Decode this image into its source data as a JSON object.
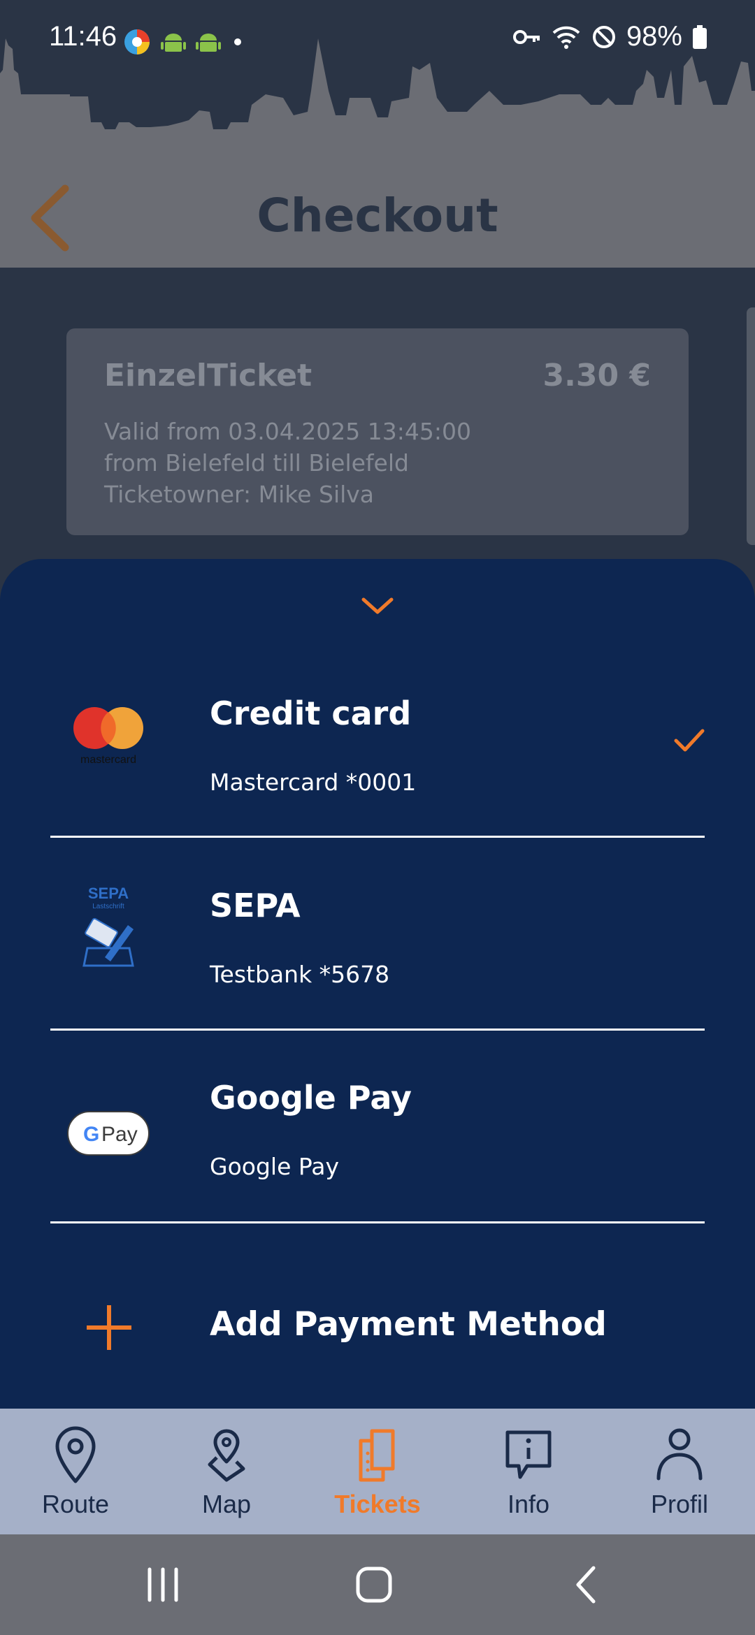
{
  "status_bar": {
    "time": "11:46",
    "battery": "98%"
  },
  "header": {
    "title": "Checkout",
    "back_icon": "chevron-left-icon"
  },
  "ticket": {
    "name": "EinzelTicket",
    "price": "3.30 €",
    "valid_from": "Valid from 03.04.2025 13:45:00",
    "route": "from Bielefeld till Bielefeld",
    "owner": "Ticketowner: Mike Silva"
  },
  "payment_sheet": {
    "collapse_icon": "chevron-down-icon",
    "methods": [
      {
        "title": "Credit card",
        "subtitle": "Mastercard *0001",
        "logo_text": "mastercard",
        "selected": true
      },
      {
        "title": "SEPA",
        "subtitle": "Testbank *5678",
        "logo_text": "SEPA",
        "logo_subtext": "Lastschrift",
        "selected": false
      },
      {
        "title": "Google Pay",
        "subtitle": "Google Pay",
        "logo_text": "Pay",
        "selected": false
      }
    ],
    "add_label": "Add Payment Method"
  },
  "bottom_nav": {
    "items": [
      {
        "label": "Route",
        "icon": "location-pin-icon"
      },
      {
        "label": "Map",
        "icon": "map-pin-icon"
      },
      {
        "label": "Tickets",
        "icon": "ticket-icon",
        "active": true
      },
      {
        "label": "Info",
        "icon": "info-bubble-icon"
      },
      {
        "label": "Profil",
        "icon": "user-icon"
      }
    ]
  },
  "colors": {
    "accent": "#f07a2a",
    "sheet_bg": "#0d2651",
    "nav_bg": "#a5b0c8",
    "header_bg": "#6b6d74",
    "card_bg": "#4c5260"
  }
}
